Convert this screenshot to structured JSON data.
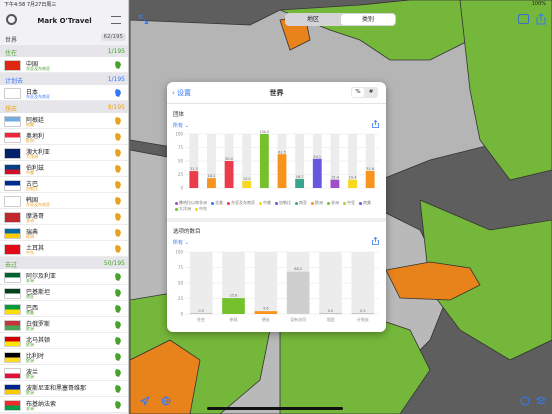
{
  "status": {
    "time": "下午4:58 7月27日周三",
    "battery": "100%"
  },
  "sidebar": {
    "app_title": "Mark O'Travel",
    "world_label": "世界",
    "world_count": "62/195",
    "sections": [
      {
        "label": "住在",
        "count": "1/195",
        "color": "#4aa02c",
        "rows": [
          {
            "name": "中国",
            "sub": "东亚及东南亚",
            "flag_colors": [
              "#de2910",
              "#de2910"
            ]
          }
        ]
      },
      {
        "label": "计划去",
        "count": "1/195",
        "color": "#3478f6",
        "rows": [
          {
            "name": "日本",
            "sub": "东亚及东南亚",
            "flag_colors": [
              "#ffffff",
              "#ffffff"
            ]
          }
        ]
      },
      {
        "label": "想去",
        "count": "9/195",
        "color": "#e8a21a",
        "rows": [
          {
            "name": "阿根廷",
            "sub": "南美",
            "flag_colors": [
              "#74acdf",
              "#ffffff"
            ]
          },
          {
            "name": "奥地利",
            "sub": "欧洲",
            "flag_colors": [
              "#ed2939",
              "#ffffff"
            ]
          },
          {
            "name": "澳大利亚",
            "sub": "大洋洲",
            "flag_colors": [
              "#012169",
              "#012169"
            ]
          },
          {
            "name": "伯利兹",
            "sub": "中美",
            "flag_colors": [
              "#003f87",
              "#ce1126"
            ]
          },
          {
            "name": "古巴",
            "sub": "加勒比",
            "flag_colors": [
              "#002a8f",
              "#ffffff"
            ]
          },
          {
            "name": "韩国",
            "sub": "东亚及东南亚",
            "flag_colors": [
              "#ffffff",
              "#ffffff"
            ]
          },
          {
            "name": "摩洛哥",
            "sub": "非洲",
            "flag_colors": [
              "#c1272d",
              "#c1272d"
            ]
          },
          {
            "name": "瑞典",
            "sub": "欧洲",
            "flag_colors": [
              "#006aa7",
              "#fecc00"
            ]
          },
          {
            "name": "土耳其",
            "sub": "中东",
            "flag_colors": [
              "#e30a17",
              "#e30a17"
            ]
          }
        ]
      },
      {
        "label": "去过",
        "count": "50/195",
        "color": "#4aa02c",
        "rows": [
          {
            "name": "阿尔及利亚",
            "sub": "非洲",
            "flag_colors": [
              "#006233",
              "#ffffff"
            ]
          },
          {
            "name": "巴基斯坦",
            "sub": "南亚",
            "flag_colors": [
              "#01411c",
              "#ffffff"
            ]
          },
          {
            "name": "巴西",
            "sub": "南美",
            "flag_colors": [
              "#009c3b",
              "#ffdf00"
            ]
          },
          {
            "name": "白俄罗斯",
            "sub": "欧洲",
            "flag_colors": [
              "#c8313e",
              "#4aa657"
            ]
          },
          {
            "name": "北马其顿",
            "sub": "欧洲",
            "flag_colors": [
              "#d20000",
              "#ffe600"
            ]
          },
          {
            "name": "比利时",
            "sub": "欧洲",
            "flag_colors": [
              "#000000",
              "#fdda24"
            ]
          },
          {
            "name": "波兰",
            "sub": "欧洲",
            "flag_colors": [
              "#ffffff",
              "#dc143c"
            ]
          },
          {
            "name": "波斯尼亚和黑塞哥维那",
            "sub": "欧洲",
            "flag_colors": [
              "#002395",
              "#fecb00"
            ]
          },
          {
            "name": "布基纳法索",
            "sub": "非洲",
            "flag_colors": [
              "#ef2b2d",
              "#009e49"
            ]
          }
        ]
      }
    ]
  },
  "topbar": {
    "tab_region": "地区",
    "tab_category": "类别",
    "active_tab": "category"
  },
  "popup": {
    "back_label": "设置",
    "title": "世界",
    "toggle_percent": "%",
    "toggle_hash": "#",
    "section1_label": "团体",
    "section1_filter": "所有",
    "section2_label": "选项的数目",
    "section2_filter": "所有"
  },
  "chart_data": [
    {
      "type": "bar",
      "title": "团体",
      "ylim": [
        0,
        100
      ],
      "yticks": [
        0,
        25,
        50,
        75,
        100
      ],
      "grid": true,
      "legend_position": "bottom",
      "groups": [
        {
          "stack": [
            {
              "value": 31.3,
              "color": "#ec3b4a"
            }
          ]
        },
        {
          "stack": [
            {
              "value": 18.2,
              "color": "#f7941d"
            }
          ]
        },
        {
          "stack": [
            {
              "value": 50.0,
              "color": "#ec3b4a"
            }
          ]
        },
        {
          "stack": [
            {
              "value": 13.0,
              "color": "#f7d91e"
            }
          ]
        },
        {
          "stack": [
            {
              "value": 100.0,
              "color": "#74c12c"
            }
          ]
        },
        {
          "stack": [
            {
              "value": 62.5,
              "color": "#f7941d"
            }
          ]
        },
        {
          "stack": [
            {
              "value": 16.7,
              "color": "#3aa58c"
            }
          ]
        },
        {
          "stack": [
            {
              "value": 54.1,
              "color": "#6656e0"
            }
          ]
        },
        {
          "stack": [
            {
              "value": 15.4,
              "color": "#a14fc8"
            }
          ]
        },
        {
          "stack": [
            {
              "value": 15.4,
              "color": "#f7d91e"
            }
          ]
        },
        {
          "stack": [
            {
              "value": 31.6,
              "color": "#f7941d"
            }
          ]
        }
      ],
      "labels": [
        "31.3",
        "18.2",
        "50.0",
        "13.0",
        "100.0",
        "62.5",
        "16.7",
        "54.1",
        "15.4",
        "15.4",
        "31.6"
      ],
      "legend": [
        {
          "name": "撒哈拉以南非洲",
          "color": "#a14fc8"
        },
        {
          "name": "北美",
          "color": "#3478f6"
        },
        {
          "name": "东亚及东南亚",
          "color": "#ec3b4a"
        },
        {
          "name": "中美",
          "color": "#f7d91e"
        },
        {
          "name": "加勒比",
          "color": "#6656e0"
        },
        {
          "name": "南亚",
          "color": "#3aa58c"
        },
        {
          "name": "欧洲",
          "color": "#f7941d"
        },
        {
          "name": "非洲",
          "color": "#74c12c"
        },
        {
          "name": "中亚",
          "color": "#a8d42c"
        },
        {
          "name": "南美",
          "color": "#6656e0"
        },
        {
          "name": "大洋洲",
          "color": "#74c12c"
        },
        {
          "name": "中东",
          "color": "#f7d91e"
        }
      ]
    },
    {
      "type": "bar",
      "title": "选项的数目",
      "ylim": [
        0,
        100
      ],
      "yticks": [
        0,
        25,
        50,
        75,
        100
      ],
      "grid": true,
      "categories": [
        "住在",
        "参观",
        "想去",
        "没有访问",
        "坦团",
        "计划去"
      ],
      "values": [
        0.5,
        25.6,
        4.6,
        68.2,
        0.5,
        0.5
      ],
      "colors": [
        "#aaaaaa",
        "#74c12c",
        "#f7941d",
        "#cfcfcf",
        "#aaaaaa",
        "#aaaaaa"
      ]
    }
  ]
}
